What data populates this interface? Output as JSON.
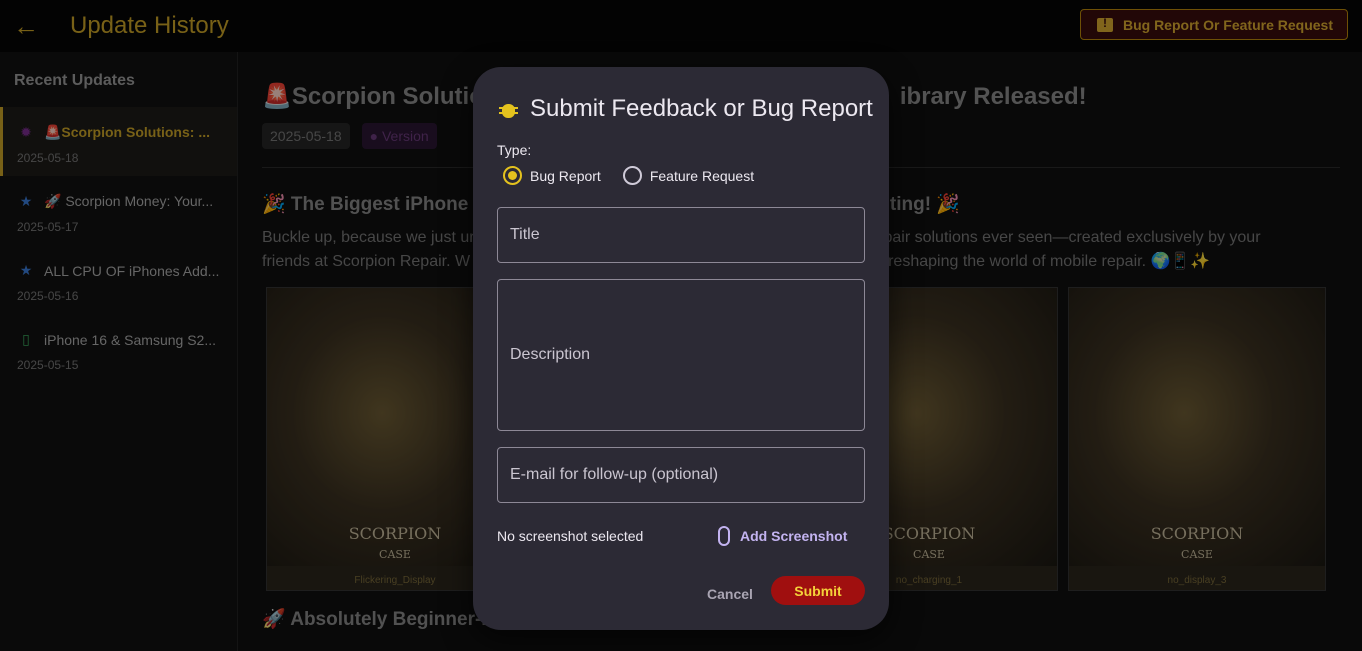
{
  "header": {
    "title": "Update History",
    "report_button": "Bug Report Or Feature Request"
  },
  "sidebar": {
    "heading": "Recent Updates",
    "items": [
      {
        "icon": "🚨",
        "label": "🚨Scorpion Solutions: ...",
        "date": "2025-05-18",
        "active": true
      },
      {
        "icon": "★",
        "label": "🚀 Scorpion Money: Your...",
        "date": "2025-05-17"
      },
      {
        "icon": "★",
        "label": "ALL CPU OF iPhones Add...",
        "date": "2025-05-16"
      },
      {
        "icon": "📱",
        "label": "iPhone 16 & Samsung S2...",
        "date": "2025-05-15"
      }
    ]
  },
  "main": {
    "title": "🚨Scorpion Solutio",
    "title_tail": "ibrary Released!",
    "date_chip": "2025-05-18",
    "version_chip": "Version",
    "section_heading": "🎉 The Biggest iPhone",
    "section_heading_tail": "nting! 🎉",
    "para_line1": "Buckle up, because we just ur",
    "para_line1_tail": "epair solutions ever seen—created exclusively by your",
    "para_line2": "friends at Scorpion Repair. W",
    "para_line2_tail": "reshaping the world of mobile repair. 🌍📱✨",
    "gallery": [
      {
        "brand": "SCORPION",
        "sub": "CASE",
        "caption": "Flickering_Display"
      },
      {
        "brand": "SCORPION",
        "sub": "CASE",
        "caption": "no_charging_1"
      },
      {
        "brand": "SCORPION",
        "sub": "CASE",
        "caption": "no_display_3"
      }
    ],
    "section2_heading": "🚀 Absolutely Beginner-F"
  },
  "modal": {
    "title": "Submit Feedback or Bug Report",
    "type_label": "Type:",
    "types": [
      {
        "label": "Bug Report",
        "selected": true
      },
      {
        "label": "Feature Request",
        "selected": false
      }
    ],
    "title_placeholder": "Title",
    "description_placeholder": "Description",
    "email_placeholder": "E-mail for follow-up (optional)",
    "screenshot_status": "No screenshot selected",
    "add_screenshot": "Add Screenshot",
    "cancel": "Cancel",
    "submit": "Submit"
  },
  "colors": {
    "accent": "#c9a227",
    "submit_bg": "#a00f0f",
    "modal_bg": "#2c2a35",
    "link": "#c3b3f0"
  }
}
